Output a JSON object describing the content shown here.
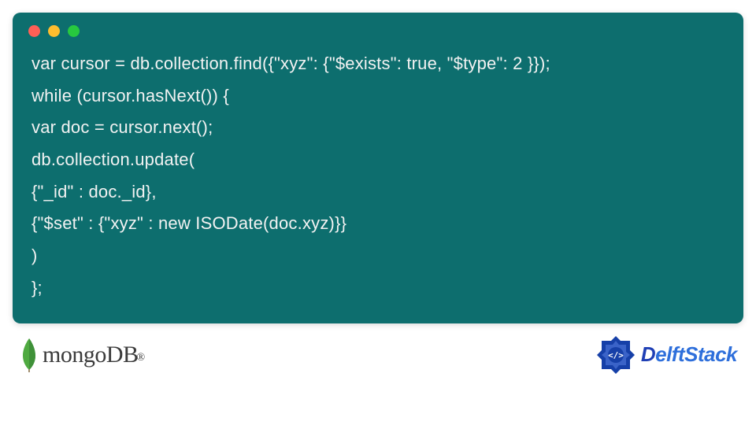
{
  "code": {
    "background": "#0d6e6e",
    "text_color": "#f2f2f2",
    "lines": [
      "var cursor = db.collection.find({\"xyz\": {\"$exists\": true, \"$type\": 2 }});",
      "while (cursor.hasNext()) {",
      "var doc = cursor.next();",
      "db.collection.update(",
      "{\"_id\" : doc._id},",
      "{\"$set\" : {\"xyz\" : new ISODate(doc.xyz)}}",
      ")",
      "};"
    ]
  },
  "window_controls": {
    "red": "#ff5f56",
    "yellow": "#ffbd2e",
    "green": "#27c93f"
  },
  "brands": {
    "mongo": {
      "name": "mongoDB",
      "registered": "®",
      "leaf_color": "#4faa41"
    },
    "delft": {
      "prefix": "D",
      "rest": "elftStack",
      "badge_color": "#1640a8"
    }
  }
}
